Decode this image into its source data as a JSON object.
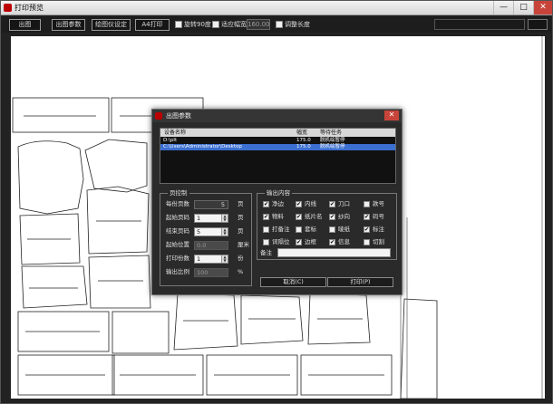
{
  "window": {
    "title": "打印预览",
    "min_glyph": "—",
    "max_glyph": "□",
    "close_glyph": "✕"
  },
  "toolbar": {
    "btn_output": "出图",
    "btn_params": "出图参数",
    "btn_plotter": "绘图仪设定",
    "btn_a4": "A4打印",
    "chk_rotate_label": "旋转90度",
    "chk_fit_width_label": "适应幅宽",
    "width_value": "160.00",
    "chk_adjust_length_label": "调整长度"
  },
  "dialog": {
    "title": "出图参数",
    "close_glyph": "✕",
    "device_list": {
      "headers": {
        "device": "设备名称",
        "width": "幅宽",
        "tasks": "等待任务"
      },
      "rows": [
        {
          "device": "D:\\plt",
          "width": "175.0",
          "tasks": "脱机绘暂停"
        },
        {
          "device": "C:\\Users\\Administrator\\Desktop",
          "width": "175.0",
          "tasks": "脱机绘暂停"
        }
      ]
    },
    "page_control": {
      "title": "页控制",
      "rows": [
        {
          "label": "每份页数",
          "value": "5",
          "unit": "页"
        },
        {
          "label": "起始页码",
          "value": "1",
          "unit": "页"
        },
        {
          "label": "结束页码",
          "value": "5",
          "unit": "页"
        },
        {
          "label": "起始位置",
          "value": "0.0",
          "unit": "厘米"
        },
        {
          "label": "打印份数",
          "value": "1",
          "unit": "份"
        },
        {
          "label": "输出比例",
          "value": "100",
          "unit": "%"
        }
      ]
    },
    "output_content": {
      "title": "输出内容",
      "items": [
        {
          "label": "净边",
          "checked": true
        },
        {
          "label": "内线",
          "checked": true
        },
        {
          "label": "刀口",
          "checked": true
        },
        {
          "label": "款号",
          "checked": false
        },
        {
          "label": "物料",
          "checked": true
        },
        {
          "label": "纸片名",
          "checked": true
        },
        {
          "label": "纱向",
          "checked": true
        },
        {
          "label": "码号",
          "checked": true
        },
        {
          "label": "打备注",
          "checked": false
        },
        {
          "label": "套标",
          "checked": false
        },
        {
          "label": "唛纸",
          "checked": false
        },
        {
          "label": "标注",
          "checked": true
        },
        {
          "label": "词隔位",
          "checked": false
        },
        {
          "label": "边框",
          "checked": true
        },
        {
          "label": "信息",
          "checked": true
        },
        {
          "label": "切割",
          "checked": false
        }
      ],
      "note_label": "备注"
    },
    "btn_cancel": "取消(C)",
    "btn_print": "打印(P)"
  },
  "icons": {
    "app": "app-logo-icon",
    "spin": "spin-arrows-icon",
    "check": "checkmark-icon"
  }
}
